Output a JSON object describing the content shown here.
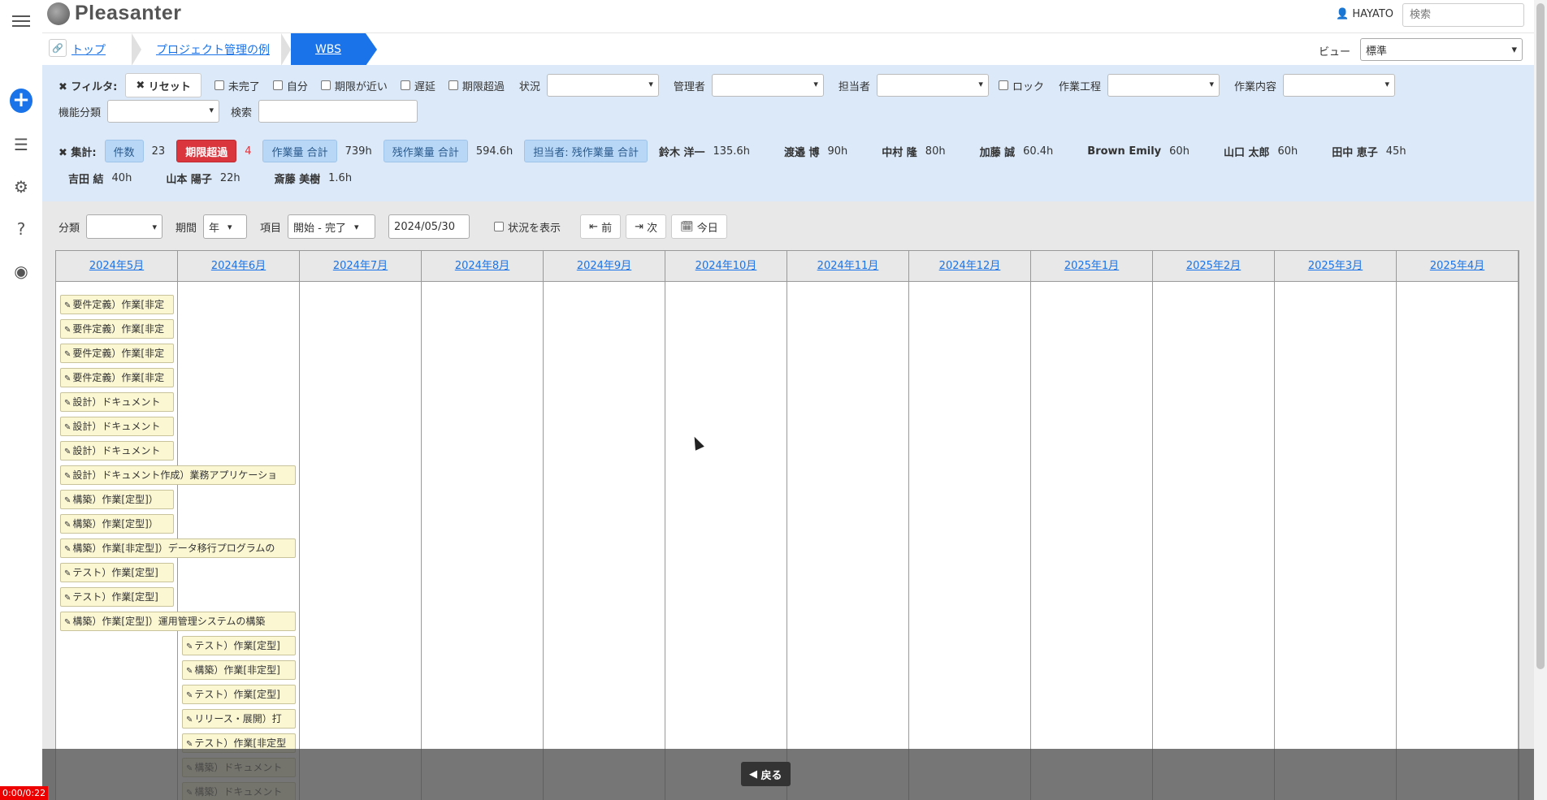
{
  "header": {
    "logo_text": "Pleasanter",
    "user": "HAYATO",
    "search_placeholder": "検索"
  },
  "breadcrumb": {
    "items": [
      "トップ",
      "プロジェクト管理の例",
      "WBS"
    ]
  },
  "view": {
    "label": "ビュー",
    "selected": "標準"
  },
  "filter": {
    "title": "フィルタ:",
    "reset": "リセット",
    "checks": [
      "未完了",
      "自分",
      "期限が近い",
      "遅延",
      "期限超過"
    ],
    "status_label": "状況",
    "manager_label": "管理者",
    "assignee_label": "担当者",
    "lock_label": "ロック",
    "process_label": "作業工程",
    "content_label": "作業内容",
    "category_label": "機能分類",
    "search_label": "検索"
  },
  "summary": {
    "title": "集計:",
    "count_label": "件数",
    "count": "23",
    "overdue_label": "期限超過",
    "overdue": "4",
    "work_label": "作業量 合計",
    "work": "739h",
    "remain_label": "残作業量 合計",
    "remain": "594.6h",
    "assignee_remain_label": "担当者: 残作業量 合計",
    "people": [
      {
        "name": "鈴木 洋一",
        "value": "135.6h"
      },
      {
        "name": "渡邉 博",
        "value": "90h"
      },
      {
        "name": "中村 隆",
        "value": "80h"
      },
      {
        "name": "加藤 誠",
        "value": "60.4h"
      },
      {
        "name": "Brown Emily",
        "value": "60h"
      },
      {
        "name": "山口 太郎",
        "value": "60h"
      },
      {
        "name": "田中 恵子",
        "value": "45h"
      },
      {
        "name": "吉田 結",
        "value": "40h"
      },
      {
        "name": "山本 陽子",
        "value": "22h"
      },
      {
        "name": "斎藤 美樹",
        "value": "1.6h"
      }
    ]
  },
  "controls": {
    "class_label": "分類",
    "period_label": "期間",
    "period": "年",
    "item_label": "項目",
    "item": "開始 - 完了",
    "date": "2024/05/30",
    "show_status": "状況を表示",
    "prev": "前",
    "next": "次",
    "today": "今日"
  },
  "months": [
    "2024年5月",
    "2024年6月",
    "2024年7月",
    "2024年8月",
    "2024年9月",
    "2024年10月",
    "2024年11月",
    "2024年12月",
    "2025年1月",
    "2025年2月",
    "2025年3月",
    "2025年4月"
  ],
  "tasks": [
    {
      "label": "要件定義）作業[非定",
      "col": 0,
      "span": 1
    },
    {
      "label": "要件定義）作業[非定",
      "col": 0,
      "span": 1
    },
    {
      "label": "要件定義）作業[非定",
      "col": 0,
      "span": 1
    },
    {
      "label": "要件定義）作業[非定",
      "col": 0,
      "span": 1
    },
    {
      "label": "設計）ドキュメント",
      "col": 0,
      "span": 1
    },
    {
      "label": "設計）ドキュメント",
      "col": 0,
      "span": 1
    },
    {
      "label": "設計）ドキュメント",
      "col": 0,
      "span": 1
    },
    {
      "label": "設計）ドキュメント作成）業務アプリケーショ",
      "col": 0,
      "span": 2
    },
    {
      "label": "構築）作業[定型]）",
      "col": 0,
      "span": 1
    },
    {
      "label": "構築）作業[定型]）",
      "col": 0,
      "span": 1
    },
    {
      "label": "構築）作業[非定型]）データ移行プログラムの",
      "col": 0,
      "span": 2
    },
    {
      "label": "テスト）作業[定型]",
      "col": 0,
      "span": 1
    },
    {
      "label": "テスト）作業[定型]",
      "col": 0,
      "span": 1
    },
    {
      "label": "構築）作業[定型]）運用管理システムの構築",
      "col": 0,
      "span": 2
    },
    {
      "label": "テスト）作業[定型]",
      "col": 1,
      "span": 1
    },
    {
      "label": "構築）作業[非定型]",
      "col": 1,
      "span": 1
    },
    {
      "label": "テスト）作業[定型]",
      "col": 1,
      "span": 1
    },
    {
      "label": "リリース・展開）打",
      "col": 1,
      "span": 1
    },
    {
      "label": "テスト）作業[非定型",
      "col": 1,
      "span": 1
    },
    {
      "label": "構築）ドキュメント",
      "col": 1,
      "span": 1
    },
    {
      "label": "構築）ドキュメント",
      "col": 1,
      "span": 1
    }
  ],
  "overlay": {
    "back": "戻る"
  },
  "timer": "0:00/0:22"
}
